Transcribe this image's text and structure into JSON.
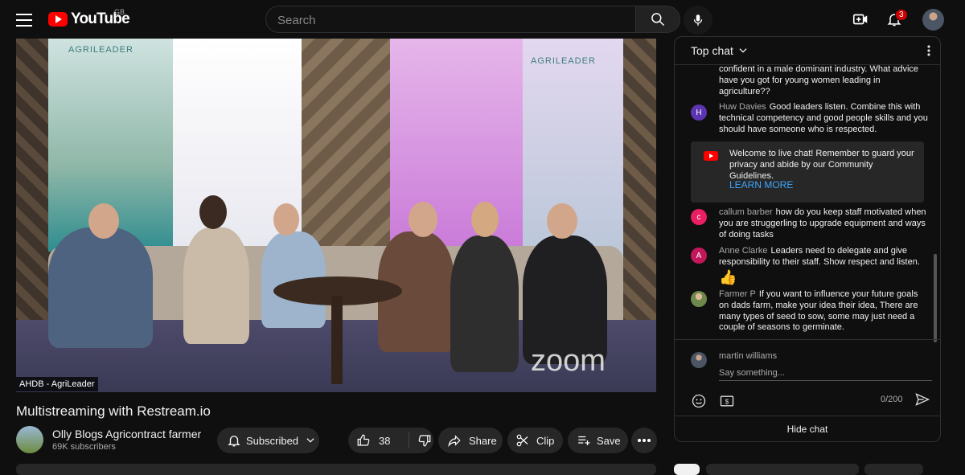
{
  "header": {
    "logo_text": "YouTube",
    "country_code": "GB",
    "search_placeholder": "Search",
    "notification_count": "3"
  },
  "video": {
    "overlay_label": "AHDB - AgriLeader",
    "banner_left_text": "AGRILEADER",
    "banner_right_text": "AGRILEADER",
    "watermark": "zoom",
    "title": "Multistreaming with Restream.io"
  },
  "channel": {
    "name": "Olly Blogs Agricontract farmer",
    "subscribers": "69K subscribers",
    "subscribed_label": "Subscribed"
  },
  "actions": {
    "like_count": "38",
    "share_label": "Share",
    "clip_label": "Clip",
    "save_label": "Save"
  },
  "chat": {
    "title": "Top chat",
    "partial_message": "confident in a male dominant industry. What advice have you got for young women leading in agriculture??",
    "messages": [
      {
        "initial": "H",
        "color": "#5e35b1",
        "author": "Huw Davies",
        "text": "Good leaders listen. Combine this with technical competency and good people skills and you should have someone who is respected."
      },
      {
        "initial": "c",
        "color": "#e91e63",
        "author": "callum barber",
        "text": "how do you keep staff motivated when you are struggerling to upgrade equipment and ways of doing tasks"
      },
      {
        "initial": "A",
        "color": "#c2185b",
        "author": "Anne Clarke",
        "text": "Leaders need to delegate and give responsibility to their staff. Show respect and listen."
      },
      {
        "initial": "",
        "color": "#8d6e63",
        "author": "Farmer P",
        "text": "If you want to influence your future goals on dads farm, make your idea their idea, There are many types of seed to sow, some may just need a couple of seasons to germinate."
      }
    ],
    "reaction_emoji": "👍",
    "notice_text": "Welcome to live chat! Remember to guard your privacy and abide by our Community Guidelines.",
    "notice_link": "LEARN MORE",
    "input_username": "martin williams",
    "input_placeholder": "Say something...",
    "char_count": "0/200",
    "hide_chat_label": "Hide chat"
  }
}
